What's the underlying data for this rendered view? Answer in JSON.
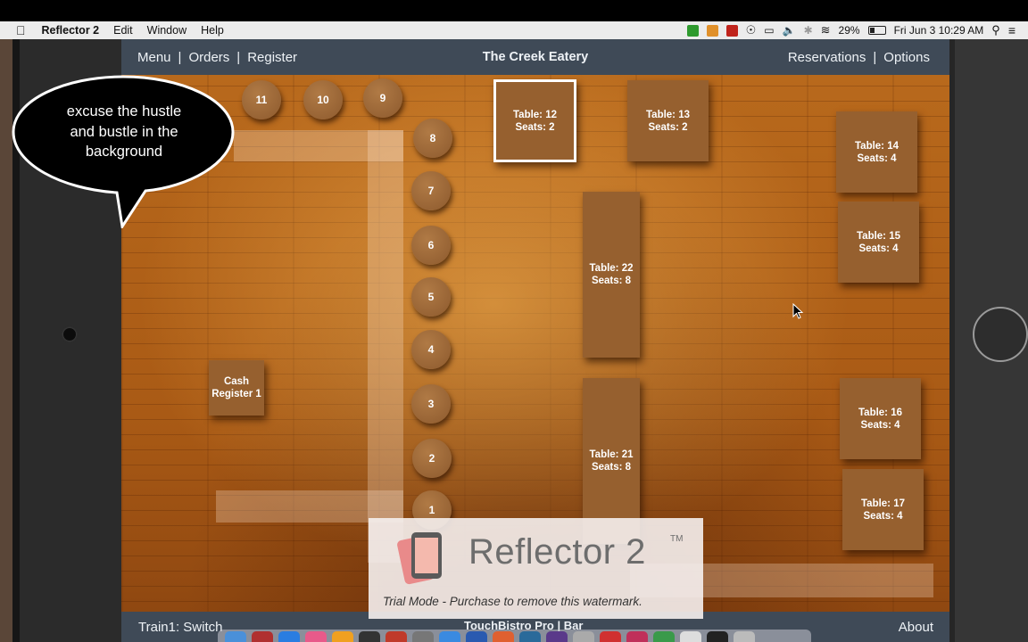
{
  "menubar": {
    "app_name": "Reflector 2",
    "items": [
      "Edit",
      "Window",
      "Help"
    ],
    "battery": "29%",
    "datetime": "Fri Jun 3  10:29 AM"
  },
  "app": {
    "title": "The Creek Eatery",
    "nav_left": [
      "Menu",
      "|",
      "Orders",
      "|",
      "Register"
    ],
    "nav_right": [
      "Reservations",
      "|",
      "Options"
    ],
    "bottom_left": "Train1: Switch",
    "bottom_center": "TouchBistro Pro | Bar",
    "bottom_right": "About"
  },
  "stools": [
    "11",
    "10",
    "9",
    "8",
    "7",
    "6",
    "5",
    "4",
    "3",
    "2",
    "1"
  ],
  "tables": [
    {
      "label": "Table: 12",
      "seats": "Seats: 2",
      "selected": true
    },
    {
      "label": "Table: 13",
      "seats": "Seats: 2"
    },
    {
      "label": "Table: 14",
      "seats": "Seats: 4"
    },
    {
      "label": "Table: 15",
      "seats": "Seats: 4"
    },
    {
      "label": "Table: 22",
      "seats": "Seats: 8"
    },
    {
      "label": "Table: 21",
      "seats": "Seats: 8"
    },
    {
      "label": "Table: 16",
      "seats": "Seats: 4"
    },
    {
      "label": "Table: 17",
      "seats": "Seats: 4"
    }
  ],
  "register": {
    "line1": "Cash",
    "line2": "Register 1"
  },
  "watermark": {
    "name": "Reflector 2",
    "tm": "TM",
    "trial": "Trial Mode - Purchase to remove this watermark."
  },
  "bubble": {
    "lines": [
      "excuse the hustle",
      "and bustle in the",
      "background"
    ]
  },
  "colors": {
    "bar_bg": "#3f4a57",
    "table_fill": "#96602f",
    "floor": "#b8691c"
  }
}
